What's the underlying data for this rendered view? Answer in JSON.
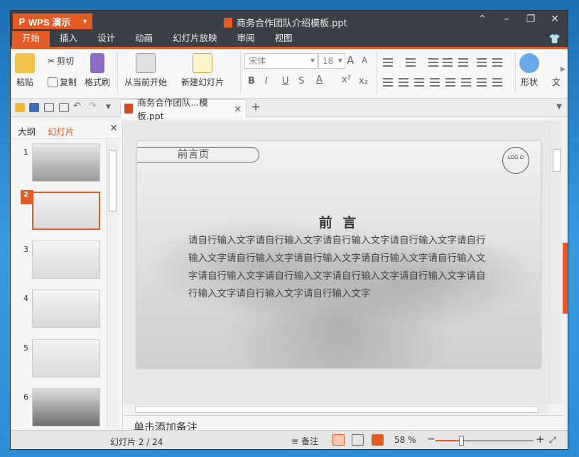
{
  "app": {
    "name": "WPS 演示",
    "logo_letter": "P"
  },
  "window": {
    "title": "商务合作团队介绍模板.ppt"
  },
  "menu": {
    "tabs": [
      "开始",
      "插入",
      "设计",
      "动画",
      "幻灯片放映",
      "审阅",
      "视图"
    ],
    "active": "开始"
  },
  "ribbon": {
    "paste": "粘贴",
    "cut": "剪切",
    "copy": "复制",
    "format_painter": "格式刷",
    "from_current": "从当前开始",
    "new_slide": "新建幻灯片",
    "font_name": "宋体",
    "font_size": "18",
    "shapes": "形状",
    "more": "文"
  },
  "doc_tab": {
    "label": "商务合作团队...模板.ppt"
  },
  "left_pane": {
    "tabs": [
      "大纲",
      "幻灯片"
    ],
    "active": "幻灯片",
    "thumbnails": [
      "1",
      "2",
      "3",
      "4",
      "5",
      "6"
    ],
    "selected": "2"
  },
  "slide": {
    "tag": "前言页",
    "logo": "LOG O",
    "heading": "前 言",
    "body": "请自行输入文字请自行输入文字请自行输入文字请自行输入文字请自行输入文字请自行输入文字请自行输入文字请自行输入文字请自行输入文字请自行输入文字请自行输入文字请自行输入文字请自行输入文字请自行输入文字请自行输入文字请自行输入文字"
  },
  "notes_placeholder": "单击添加备注",
  "status": {
    "slide_info": "幻灯片 2 / 24",
    "notes": "备注",
    "zoom": "58 %",
    "zoom_fraction": 0.26
  },
  "colors": {
    "accent": "#e55b25",
    "titlebar": "#3c4046"
  }
}
